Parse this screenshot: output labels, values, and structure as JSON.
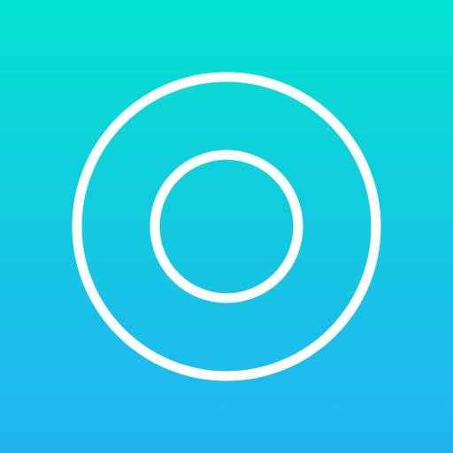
{
  "icon": {
    "name": "target-rings-icon",
    "gradient_top": "#03E1CE",
    "gradient_bottom": "#22B3F3",
    "ring_color": "#FFFFFF"
  }
}
